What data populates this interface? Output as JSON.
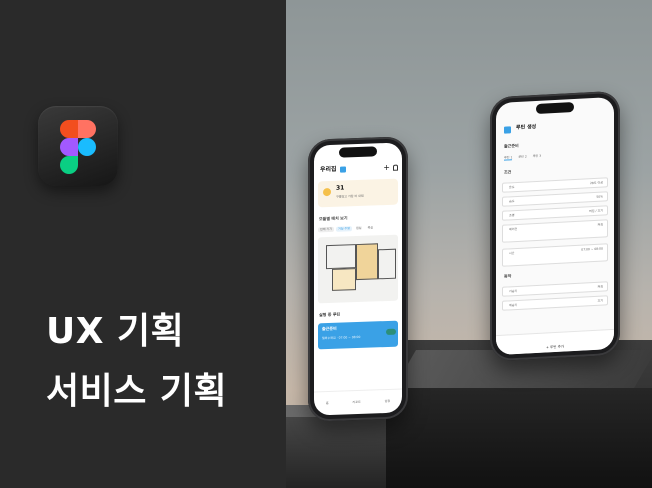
{
  "headline": {
    "line1": "UX 기획",
    "line2": "서비스 기획"
  },
  "colors": {
    "accent": "#3aa1e6",
    "figma_red": "#f24e1e",
    "figma_orange": "#ff7262",
    "figma_purple": "#a259ff",
    "figma_blue": "#1abcfe",
    "figma_green": "#0acf83"
  },
  "phone1": {
    "title": "우리집",
    "plus_icon": "+",
    "weather": {
      "temp": "31",
      "desc": "구름많고 가끔 비 내림"
    },
    "floor_title": "모듈별 배치 보기",
    "tabs": [
      "전체 기기",
      "거실·주방",
      "침실",
      "욕실",
      "작은방"
    ],
    "routine_header": "실행 중 루틴",
    "routine_card": {
      "title": "출근준비",
      "sub": "월화수목금 · 07:00 ~ 08:00"
    },
    "nav": [
      "홈",
      "리포트",
      "설정"
    ]
  },
  "phone2": {
    "title": "루틴 생성",
    "section1": "출근준비",
    "tabs": [
      "루틴 1",
      "루틴 2",
      "루틴 3"
    ],
    "group1": "조건",
    "rows": [
      {
        "label": "온도",
        "value": "28도 이상"
      },
      {
        "label": "습도",
        "value": "50%"
      },
      {
        "label": "조명",
        "value": "켜짐 / 끄기"
      },
      {
        "label": "에어컨",
        "value": "켜짐"
      },
      {
        "label": "시간",
        "value": "07:00 ~ 08:00"
      }
    ],
    "group2": "동작",
    "rows2": [
      {
        "label": "가습기",
        "value": "켜짐"
      },
      {
        "label": "제습기",
        "value": "끄기"
      }
    ],
    "add_button": "+ 루틴 추가"
  }
}
